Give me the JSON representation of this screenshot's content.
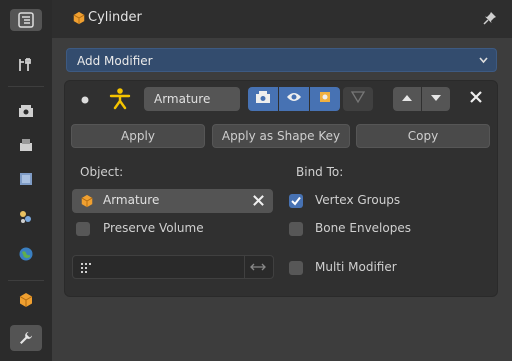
{
  "header": {
    "title": "Cylinder"
  },
  "add_modifier": {
    "label": "Add Modifier"
  },
  "modifier": {
    "name": "Armature",
    "buttons": {
      "apply": "Apply",
      "apply_shape_key": "Apply as Shape Key",
      "copy": "Copy"
    },
    "object_label": "Object:",
    "object_value": "Armature",
    "bind_to_label": "Bind To:",
    "preserve_volume": {
      "label": "Preserve Volume",
      "checked": false
    },
    "vertex_groups": {
      "label": "Vertex Groups",
      "checked": true
    },
    "bone_envelopes": {
      "label": "Bone Envelopes",
      "checked": false
    },
    "multi_modifier": {
      "label": "Multi Modifier",
      "checked": false
    },
    "vertex_group_value": ""
  },
  "colors": {
    "accent": "#4772b3",
    "add_modifier_bg": "#334c6e",
    "object_icon": "#f0a030"
  },
  "sidebar_icons": [
    "outliner-icon",
    "tool-icon",
    "render-icon",
    "output-icon",
    "view-layer-icon",
    "scene-icon",
    "world-icon",
    "object-icon",
    "modifier-wrench-icon"
  ]
}
